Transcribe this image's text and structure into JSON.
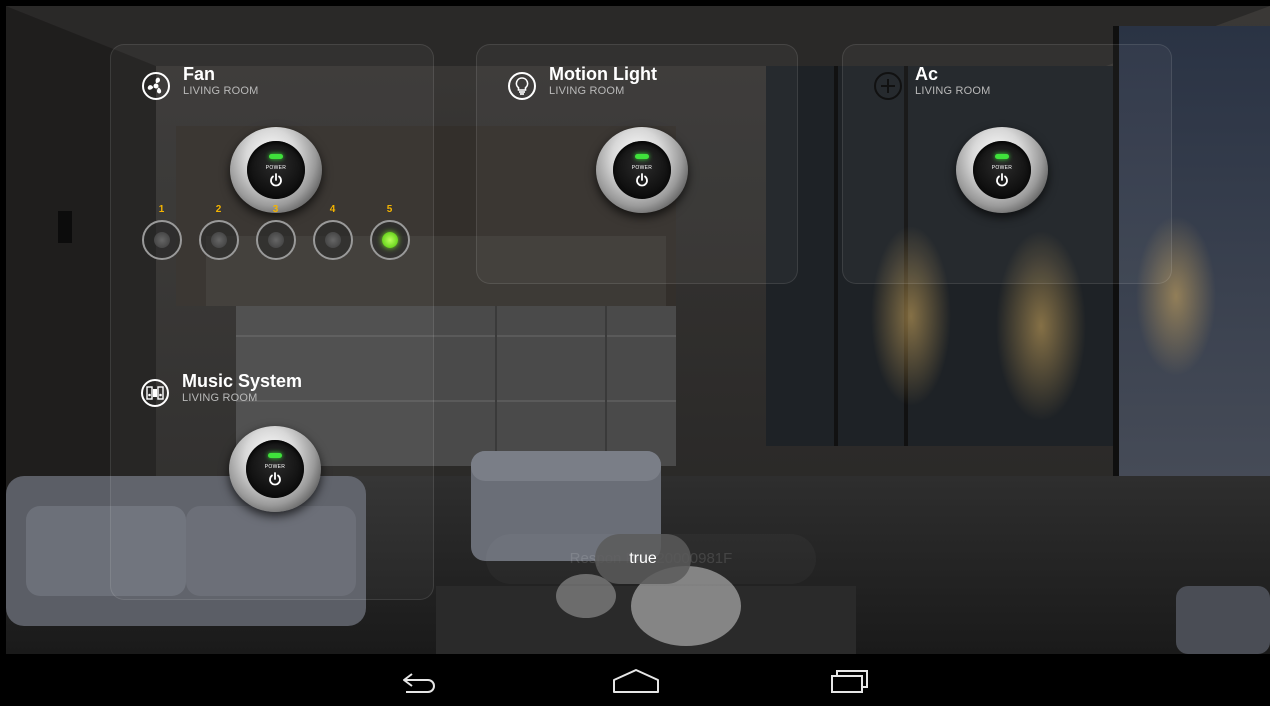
{
  "devices": [
    {
      "name": "Fan",
      "room": "LIVING ROOM",
      "icon": "fan-icon",
      "power_label": "POWER"
    },
    {
      "name": "Motion Light",
      "room": "LIVING ROOM",
      "icon": "bulb-icon",
      "power_label": "POWER"
    },
    {
      "name": "Ac",
      "room": "LIVING ROOM",
      "icon": "plus-circle-icon",
      "power_label": "POWER"
    },
    {
      "name": "Music System",
      "room": "LIVING ROOM",
      "icon": "speaker-icon",
      "power_label": "POWER"
    }
  ],
  "fan_speeds": {
    "labels": [
      "1",
      "2",
      "3",
      "4",
      "5"
    ],
    "active": "5"
  },
  "toast": {
    "text": "true",
    "background_text": "Respon Pab                    20000981F"
  },
  "navbar": {
    "buttons": [
      "back-icon",
      "home-icon",
      "recents-icon"
    ]
  },
  "colors": {
    "led_on": "#3fe23b",
    "speed_label": "#f4b400",
    "speed_active": "#6bd51f"
  }
}
